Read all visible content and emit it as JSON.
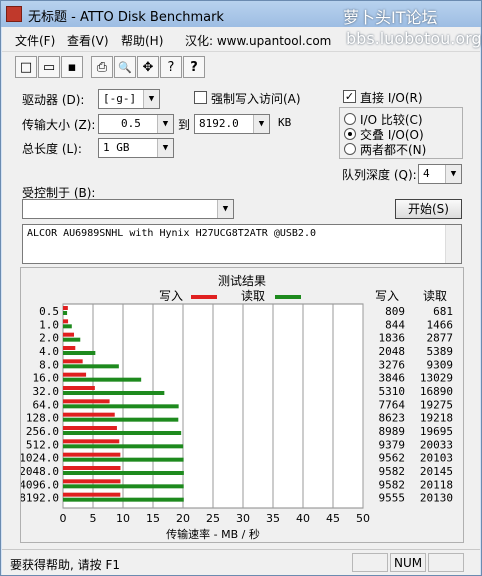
{
  "window": {
    "title": "无标题 - ATTO Disk Benchmark",
    "watermark_line1": "萝卜头IT论坛",
    "watermark_line2": "bbs.luobotou.org"
  },
  "menu": {
    "file": "文件(F)",
    "view": "查看(V)",
    "help": "帮助(H)",
    "localized": "汉化: www.upantool.com"
  },
  "toolbar": {
    "icons": [
      "new-icon",
      "open-icon",
      "save-icon",
      "print-icon",
      "print-preview-icon",
      "move-icon",
      "help-icon",
      "context-help-icon"
    ],
    "glyphs": [
      "□",
      "▭",
      "▪",
      "⎙",
      "🔍",
      "✥",
      "?",
      "?"
    ]
  },
  "settings": {
    "drive_label": "驱动器 (D):",
    "drive_value": "[-g-]",
    "force_write_label": "强制写入访问(A)",
    "transfer_size_label": "传输大小 (Z):",
    "transfer_from": "0.5",
    "to_label": "到",
    "transfer_to": "8192.0",
    "kb_label": "KB",
    "total_length_label": "总长度 (L):",
    "total_length_value": "1 GB",
    "direct_io_label": "直接 I/O(R)",
    "io_compare_label": "I/O 比较(C)",
    "overlapped_io_label": "交叠 I/O(O)",
    "neither_label": "两者都不(N)",
    "queue_depth_label": "队列深度 (Q):",
    "queue_depth_value": "4",
    "controlled_by_label": "受控制于 (B):",
    "controlled_by_value": "",
    "start_button": "开始(S)",
    "description": "ALCOR AU6989SNHL with Hynix H27UCG8T2ATR @USB2.0"
  },
  "chart_data": {
    "type": "bar",
    "title": "测试结果",
    "xlabel": "传输速率 - MB / 秒",
    "xlim": [
      0,
      50
    ],
    "xticks": [
      "0",
      "5",
      "10",
      "15",
      "20",
      "25",
      "30",
      "35",
      "40",
      "45",
      "50"
    ],
    "grid": true,
    "legend": [
      {
        "name": "写入",
        "color": "#e02020"
      },
      {
        "name": "读取",
        "color": "#1e8a1e"
      }
    ],
    "table_headers": {
      "write": "写入",
      "read": "读取"
    },
    "categories": [
      "0.5",
      "1.0",
      "2.0",
      "4.0",
      "8.0",
      "16.0",
      "32.0",
      "64.0",
      "128.0",
      "256.0",
      "512.0",
      "1024.0",
      "2048.0",
      "4096.0",
      "8192.0"
    ],
    "series": [
      {
        "name": "写入",
        "color": "#e02020",
        "values": [
          809,
          844,
          1836,
          2048,
          3276,
          3846,
          5310,
          7764,
          8623,
          8989,
          9379,
          9562,
          9582,
          9582,
          9555
        ]
      },
      {
        "name": "读取",
        "color": "#1e8a1e",
        "values": [
          681,
          1466,
          2877,
          5389,
          9309,
          13029,
          16890,
          19275,
          19218,
          19695,
          20033,
          20103,
          20145,
          20118,
          20130
        ]
      }
    ],
    "units_per_mb": 1000
  },
  "status": {
    "help_text": "要获得帮助, 请按 F1",
    "num": "NUM"
  }
}
